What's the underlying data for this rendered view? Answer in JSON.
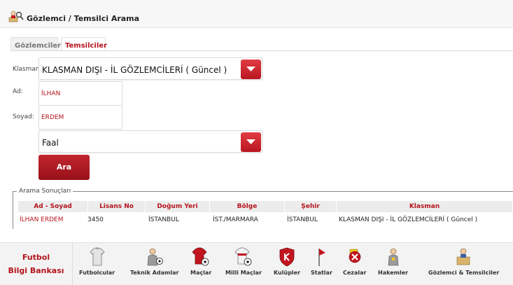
{
  "header": {
    "title": "Gözlemci / Temsilci Arama",
    "icon": "observer-search-icon"
  },
  "tabs": [
    {
      "label": "Gözlemciler",
      "active": false
    },
    {
      "label": "Temsilciler",
      "active": true
    }
  ],
  "form": {
    "klasman_label": "Klasman:",
    "klasman_value": "KLASMAN DIŞI - İL GÖZLEMCİLERİ ( Güncel  )",
    "ad_label": "Ad:",
    "ad_value": "İLHAN",
    "soyad_label": "Soyad:",
    "soyad_value": "ERDEM",
    "status_value": "Faal",
    "search_label": "Ara"
  },
  "results": {
    "legend": "Arama Sonuçları",
    "columns": [
      "Ad - Soyad",
      "Lisans No",
      "Doğum Yeri",
      "Bölge",
      "Şehir",
      "Klasman"
    ],
    "rows": [
      [
        "İLHAN ERDEM",
        "3450",
        "İSTANBUL",
        "İST./MARMARA",
        "İSTANBUL",
        "KLASMAN DIŞI - İL GÖZLEMCİLERİ ( Güncel )"
      ]
    ]
  },
  "bottom_nav": {
    "brand_line1": "Futbol",
    "brand_line2": "Bilgi Bankası",
    "items": [
      {
        "label": "Futbolcular",
        "icon": "player-shirt-icon"
      },
      {
        "label": "Teknik Adamlar",
        "icon": "coach-icon"
      },
      {
        "label": "Maçlar",
        "icon": "match-shirt-icon"
      },
      {
        "label": "Milli Maçlar",
        "icon": "national-shirt-icon"
      },
      {
        "label": "Kulüpler",
        "icon": "club-badge-icon"
      },
      {
        "label": "Statlar",
        "icon": "stadium-flag-icon"
      },
      {
        "label": "Cezalar",
        "icon": "penalty-icon"
      },
      {
        "label": "Hakemler",
        "icon": "referee-icon"
      },
      {
        "label": "Gözlemci & Temsilciler",
        "icon": "observer-icon"
      }
    ]
  },
  "colors": {
    "accent": "#b4141c",
    "button_red": "#c1262e"
  }
}
